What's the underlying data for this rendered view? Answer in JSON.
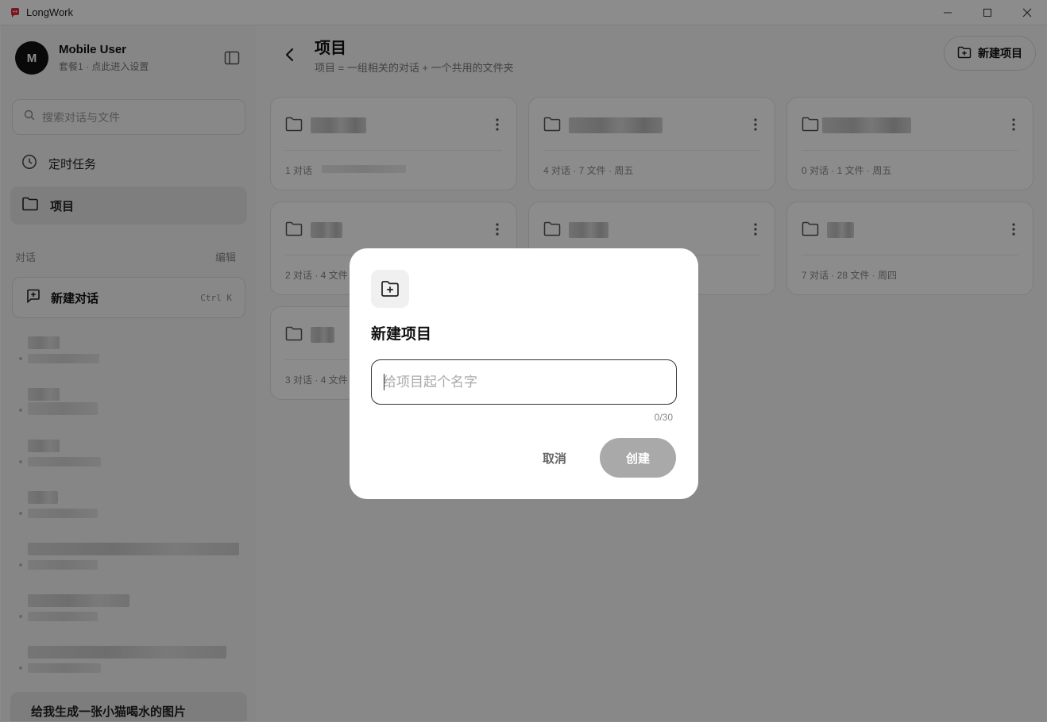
{
  "window": {
    "title": "LongWork"
  },
  "sidebar": {
    "user": {
      "initial": "M",
      "name": "Mobile User",
      "plan": "套餐1 · 点此进入设置"
    },
    "search": {
      "placeholder": "搜索对话与文件"
    },
    "nav": [
      {
        "label": "定时任务",
        "icon": "clock-icon"
      },
      {
        "label": "项目",
        "icon": "folder-icon",
        "active": true
      }
    ],
    "section": {
      "label": "对话",
      "edit_label": "编辑"
    },
    "new_chat": {
      "label": "新建对话",
      "shortcut": "Ctrl K"
    },
    "active_conversation": "给我生成一张小猫喝水的图片"
  },
  "main": {
    "title": "项目",
    "subtitle": "项目 = 一组相关的对话 + 一个共用的文件夹",
    "new_project_label": "新建项目",
    "projects": [
      {
        "meta": "1 对话"
      },
      {
        "meta": "4 对话 · 7 文件 · 周五"
      },
      {
        "meta": "0 对话 · 1 文件 · 周五"
      },
      {
        "meta": "2 对话 · 4 文件"
      },
      {
        "meta": ""
      },
      {
        "meta": "7 对话 · 28 文件 · 周四"
      },
      {
        "meta": "3 对话 · 4 文件"
      }
    ]
  },
  "modal": {
    "title": "新建项目",
    "input_placeholder": "给项目起个名字",
    "input_value": "",
    "counter": "0/30",
    "cancel_label": "取消",
    "create_label": "创建"
  },
  "colors": {
    "accent": "#111111",
    "brand_icon": "#e0283c",
    "disabled_button": "#a9a9a9"
  }
}
